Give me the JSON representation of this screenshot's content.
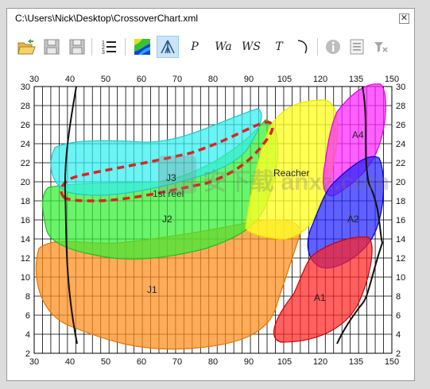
{
  "window": {
    "title": "C:\\Users\\Nick\\Desktop\\CrossoverChart.xml",
    "close_glyph": "✕"
  },
  "toolbar": {
    "items": [
      {
        "icon": "open-folder-icon"
      },
      {
        "icon": "save-icon"
      },
      {
        "icon": "save-as-icon"
      },
      {
        "icon": "numbered-list-icon"
      },
      {
        "icon": "color-map-icon"
      },
      {
        "icon": "tent-icon",
        "active": true
      },
      {
        "label": "P"
      },
      {
        "label": "Wa"
      },
      {
        "label": "WS"
      },
      {
        "label": "T"
      },
      {
        "icon": "curve-icon"
      },
      {
        "icon": "info-icon"
      },
      {
        "icon": "checklist-icon"
      },
      {
        "icon": "filter-icon"
      }
    ]
  },
  "chart_data": {
    "type": "area",
    "x_ticks": [
      "30",
      "40",
      "50",
      "60",
      "70",
      "80",
      "90",
      "105",
      "120",
      "135",
      "150"
    ],
    "y_ticks": [
      "2",
      "4",
      "6",
      "8",
      "10",
      "12",
      "14",
      "16",
      "18",
      "20",
      "22",
      "24",
      "26",
      "28",
      "30"
    ],
    "ylim": [
      2,
      30
    ],
    "grid": true,
    "regions": [
      {
        "name": "J1",
        "color": "#ff8c1a"
      },
      {
        "name": "J2",
        "color": "#33ee33"
      },
      {
        "name": "J3",
        "color": "#33eeee"
      },
      {
        "name": "Reacher",
        "color": "#ffff22"
      },
      {
        "name": "A1",
        "color": "#ff2222"
      },
      {
        "name": "A2",
        "color": "#2222ff"
      },
      {
        "name": "A4",
        "color": "#ff22ff"
      }
    ],
    "annotations": [
      "1st reel"
    ],
    "watermark": "安下载 anxz.com"
  }
}
